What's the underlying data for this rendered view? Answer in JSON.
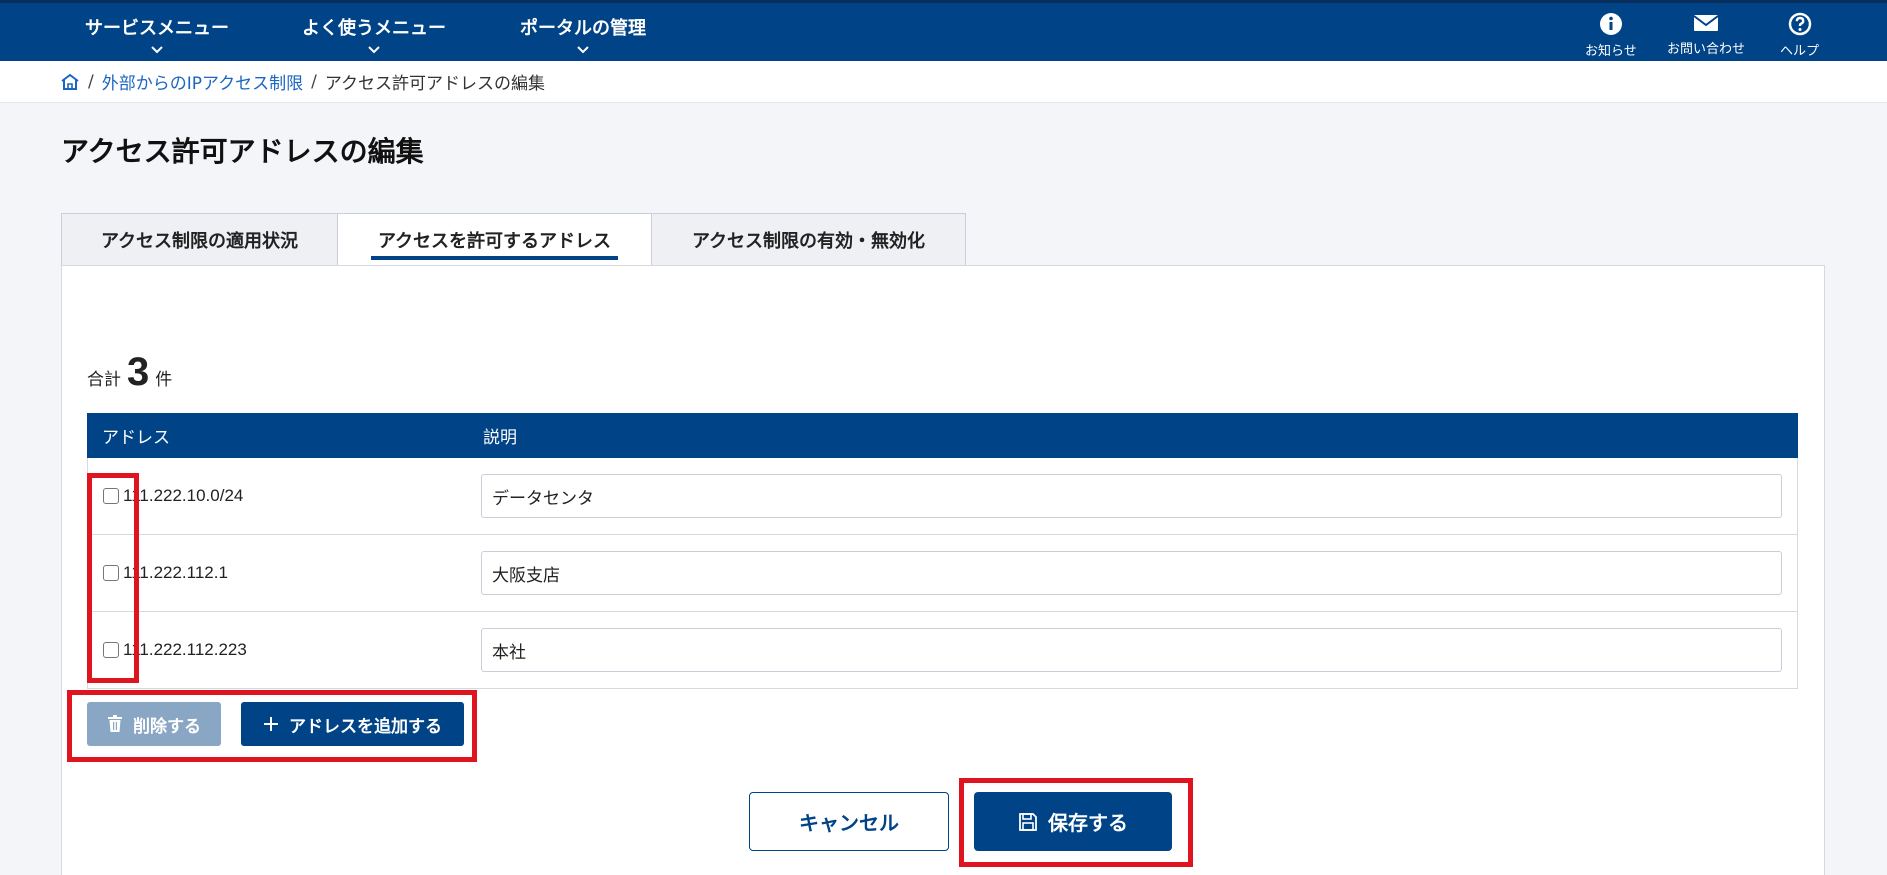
{
  "nav": {
    "menus": [
      "サービスメニュー",
      "よく使うメニュー",
      "ポータルの管理"
    ],
    "right": [
      {
        "label": "お知らせ",
        "icon": "info-icon"
      },
      {
        "label": "お問い合わせ",
        "icon": "mail-icon"
      },
      {
        "label": "ヘルプ",
        "icon": "help-icon"
      }
    ]
  },
  "breadcrumb": {
    "link": "外部からのIPアクセス制限",
    "current": "アクセス許可アドレスの編集"
  },
  "page": {
    "title": "アクセス許可アドレスの編集"
  },
  "tabs": [
    "アクセス制限の適用状況",
    "アクセスを許可するアドレス",
    "アクセス制限の有効・無効化"
  ],
  "summary": {
    "prefix": "合計",
    "count": "3",
    "suffix": "件"
  },
  "table": {
    "headers": [
      "アドレス",
      "説明"
    ],
    "rows": [
      {
        "address": "111.222.10.0/24",
        "description": "データセンタ"
      },
      {
        "address": "111.222.112.1",
        "description": "大阪支店"
      },
      {
        "address": "111.222.112.223",
        "description": "本社"
      }
    ]
  },
  "actions": {
    "delete_label": "削除する",
    "add_label": "アドレスを追加する",
    "cancel_label": "キャンセル",
    "save_label": "保存する"
  },
  "colors": {
    "primary": "#004386",
    "highlight": "#e0141f",
    "disabled": "#8aa6c5"
  }
}
